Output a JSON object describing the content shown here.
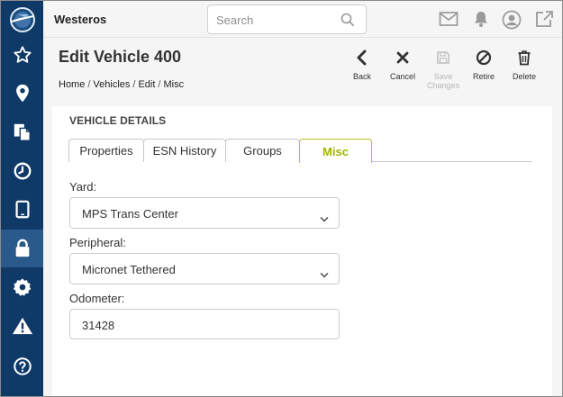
{
  "app": {
    "name": "Westeros"
  },
  "search": {
    "placeholder": "Search"
  },
  "header": {
    "title": "Edit Vehicle 400",
    "breadcrumb": [
      "Home",
      "Vehicles",
      "Edit",
      "Misc"
    ]
  },
  "toolbar": {
    "back": "Back",
    "cancel": "Cancel",
    "save": "Save Changes",
    "retire": "Retire",
    "delete": "Delete"
  },
  "sidebar": {
    "items": [
      {
        "icon": "logo-icon"
      },
      {
        "icon": "star-icon"
      },
      {
        "icon": "map-pin-icon"
      },
      {
        "icon": "documents-icon"
      },
      {
        "icon": "clock-icon"
      },
      {
        "icon": "tablet-icon"
      },
      {
        "icon": "lock-icon",
        "active": true
      },
      {
        "icon": "gear-icon"
      },
      {
        "icon": "warning-icon"
      },
      {
        "icon": "help-icon"
      }
    ]
  },
  "section": {
    "title": "VEHICLE DETAILS"
  },
  "tabs": [
    {
      "label": "Properties"
    },
    {
      "label": "ESN History"
    },
    {
      "label": "Groups"
    },
    {
      "label": "Misc",
      "active": true
    }
  ],
  "form": {
    "yard_label": "Yard:",
    "yard_value": "MPS Trans Center",
    "peripheral_label": "Peripheral:",
    "peripheral_value": "Micronet Tethered",
    "odometer_label": "Odometer:",
    "odometer_value": "31428"
  },
  "colors": {
    "sidebar": "#0f3a68",
    "sidebar_active": "#2a5a8c",
    "tab_active": "#a4b300",
    "background": "#f5f5f5"
  }
}
